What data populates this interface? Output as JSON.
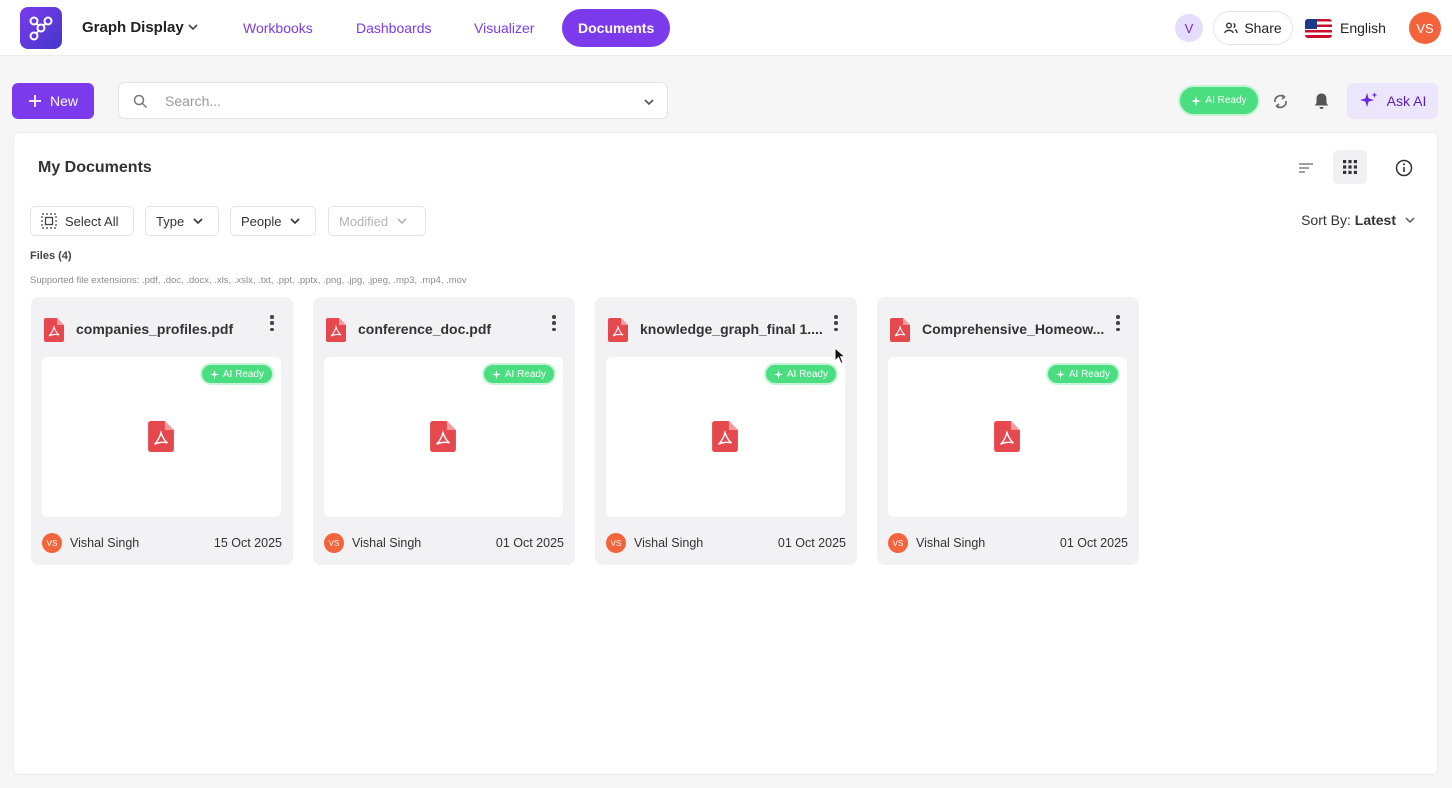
{
  "header": {
    "app_title": "Graph Display",
    "nav": [
      {
        "label": "Workbooks",
        "active": false
      },
      {
        "label": "Dashboards",
        "active": false
      },
      {
        "label": "Visualizer",
        "active": false
      },
      {
        "label": "Documents",
        "active": true
      }
    ],
    "user_initial": "V",
    "share_label": "Share",
    "language": "English",
    "avatar_initials": "VS"
  },
  "toolbar": {
    "new_label": "New",
    "search_placeholder": "Search...",
    "ai_ready_label": "AI Ready",
    "ask_ai_label": "Ask AI"
  },
  "panel": {
    "title": "My Documents",
    "filters": {
      "select_all": "Select All",
      "type": "Type",
      "people": "People",
      "modified": "Modified"
    },
    "sort_prefix": "Sort By:",
    "sort_value": "Latest",
    "files_count": "Files (4)",
    "supported": "Supported file extensions: .pdf, .doc, .docx, .xls, .xslx, .txt, .ppt, .pptx, .png, .jpg, .jpeg, .mp3, .mp4, .mov"
  },
  "files": [
    {
      "name": "companies_profiles.pdf",
      "badge": "AI Ready",
      "owner_initials": "VS",
      "owner": "Vishal Singh",
      "date": "15 Oct 2025"
    },
    {
      "name": "conference_doc.pdf",
      "badge": "AI Ready",
      "owner_initials": "VS",
      "owner": "Vishal Singh",
      "date": "01 Oct 2025"
    },
    {
      "name": "knowledge_graph_final 1....",
      "badge": "AI Ready",
      "owner_initials": "VS",
      "owner": "Vishal Singh",
      "date": "01 Oct 2025"
    },
    {
      "name": "Comprehensive_Homeow...",
      "badge": "AI Ready",
      "owner_initials": "VS",
      "owner": "Vishal Singh",
      "date": "01 Oct 2025"
    }
  ],
  "colors": {
    "brand": "#7c3aed",
    "ai_green": "#4ade80",
    "pdf_red": "#e5484d",
    "avatar_orange": "#f4643c"
  },
  "icons": [
    "app-logo",
    "chevron-down-icon",
    "people-icon",
    "us-flag-icon",
    "plus-icon",
    "search-icon",
    "sparkle-icon",
    "sync-icon",
    "bell-icon",
    "sort-lines-icon",
    "grid-icon",
    "info-icon",
    "select-all-icon",
    "pdf-icon",
    "more-vertical-icon"
  ]
}
